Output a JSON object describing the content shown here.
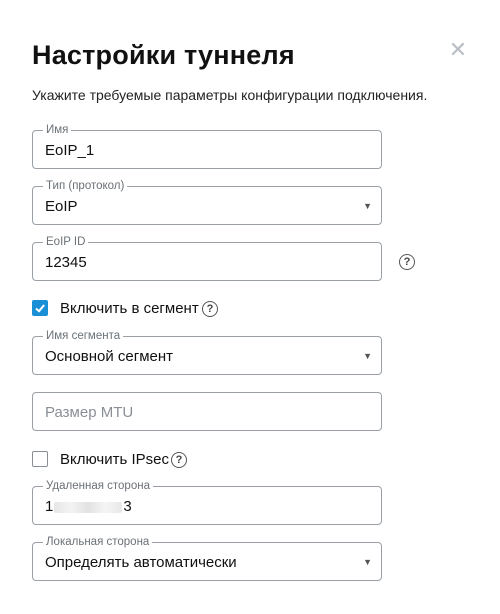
{
  "dialog": {
    "title": "Настройки туннеля",
    "subtitle": "Укажите требуемые параметры конфигурации подключения.",
    "close_icon": "close-icon"
  },
  "fields": {
    "name": {
      "legend": "Имя",
      "value": "EoIP_1"
    },
    "type": {
      "legend": "Тип (протокол)",
      "value": "EoIP"
    },
    "eoip_id": {
      "legend": "EoIP ID",
      "value": "12345"
    },
    "segment_name": {
      "legend": "Имя сегмента",
      "value": "Основной сегмент"
    },
    "mtu": {
      "placeholder": "Размер MTU"
    },
    "remote": {
      "legend": "Удаленная сторона",
      "value_start": "1",
      "value_end": "3"
    },
    "local": {
      "legend": "Локальная сторона",
      "value": "Определять автоматически"
    }
  },
  "checkboxes": {
    "segment": {
      "label": "Включить в сегмент",
      "checked": true
    },
    "ipsec": {
      "label": "Включить IPsec",
      "checked": false
    }
  },
  "colors": {
    "accent": "#1a8fd6",
    "border": "#9aa0a6",
    "muted": "#6b7177"
  }
}
